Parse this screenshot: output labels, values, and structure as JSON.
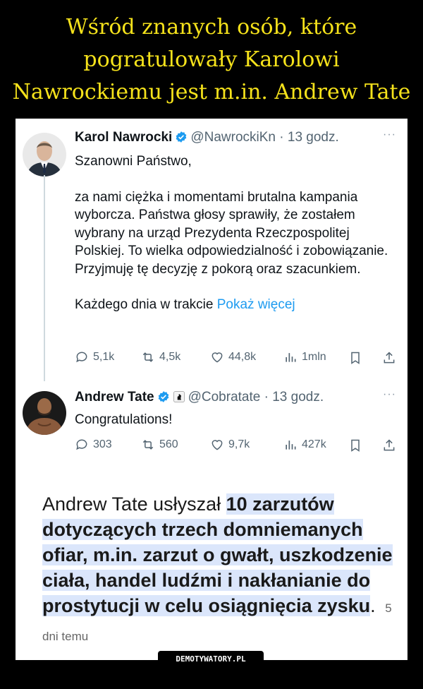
{
  "headline": {
    "line1": "Wśród znanych osób, które",
    "line2": "pogratulowały Karolowi",
    "line3": "Nawrockiemu jest m.in. Andrew Tate"
  },
  "tweets": [
    {
      "author": "Karol Nawrocki",
      "handle": "@NawrockiKn",
      "time": "· 13 godz.",
      "more": "···",
      "paragraphs": [
        "Szanowni Państwo,",
        "za nami ciężka i momentami brutalna kampania wyborcza. Państwa głosy sprawiły, że zostałem wybrany na urząd Prezydenta Rzeczpospolitej Polskiej. To wielka odpowiedzialność i zobowiązanie. Przyjmuję tę decyzję z pokorą oraz szacunkiem.",
        "Każdego dnia w trakcie"
      ],
      "show_more": "Pokaż więcej",
      "stats": {
        "replies": "5,1k",
        "reposts": "4,5k",
        "likes": "44,8k",
        "views": "1mln"
      }
    },
    {
      "author": "Andrew Tate",
      "handle": "@Cobratate",
      "time": "· 13 godz.",
      "more": "···",
      "paragraphs": [
        "Congratulations!"
      ],
      "stats": {
        "replies": "303",
        "reposts": "560",
        "likes": "9,7k",
        "views": "427k"
      }
    }
  ],
  "article": {
    "lead": "Andrew Tate usłyszał",
    "highlight": "10 zarzutów dotyczących trzech domniemanych ofiar, m.in. zarzut o gwałt, uszkodzenie ciała, handel ludźmi i nakłanianie do prostytucji w celu osiągnięcia zysku",
    "tail": ".",
    "ago": "5 dni temu"
  },
  "watermark": "DEMOTYWATORY.PL",
  "colors": {
    "headline": "#f5e21b",
    "link": "#1d9bf0",
    "verified": "#1d9bf0",
    "highlight": "#dbe6fb"
  },
  "icons": [
    "reply-icon",
    "repost-icon",
    "like-icon",
    "views-icon",
    "bookmark-icon",
    "share-icon",
    "verified-badge-icon"
  ]
}
